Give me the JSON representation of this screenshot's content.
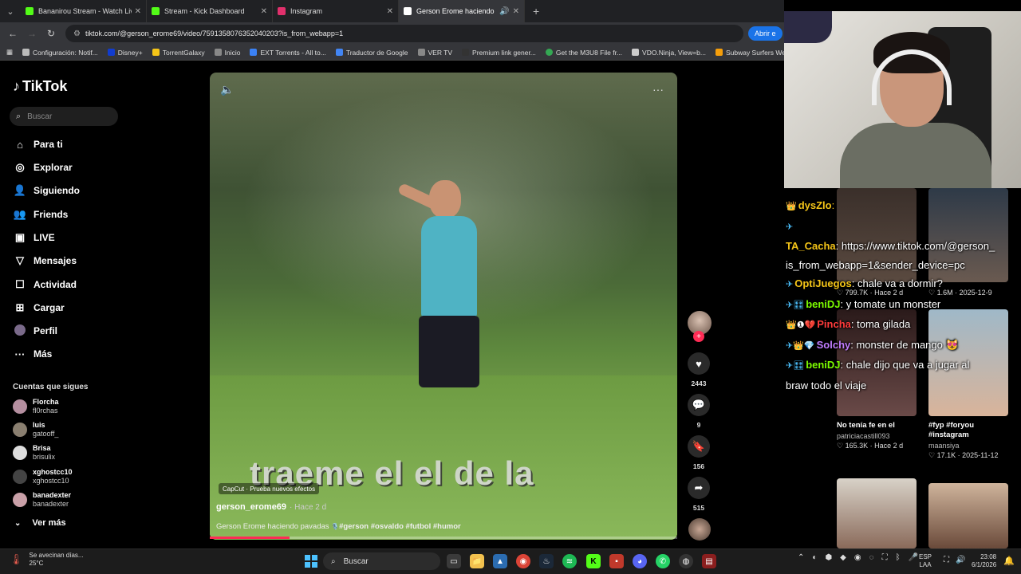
{
  "browser": {
    "tabs": [
      {
        "title": "Bananirou Stream - Watch Live",
        "favicon": "kick-icon",
        "color": "#53fc18"
      },
      {
        "title": "Stream - Kick Dashboard",
        "favicon": "kick-icon",
        "color": "#53fc18"
      },
      {
        "title": "Instagram",
        "favicon": "instagram-icon",
        "color": "#e1306c"
      },
      {
        "title": "Gerson Erome haciendo pa",
        "favicon": "tiktok-icon",
        "color": "#ffffff"
      }
    ],
    "url": "tiktok.com/@gerson_erome69/video/7591358076352040203?is_from_webapp=1",
    "open_app_label": "Abrir e",
    "bookmarks": [
      {
        "label": "Configuración: Notif...",
        "color": "#bbbbbb"
      },
      {
        "label": "Disney+",
        "color": "#113ccf"
      },
      {
        "label": "TorrentGalaxy",
        "color": "#f5c518"
      },
      {
        "label": "Inicio",
        "color": "#888888"
      },
      {
        "label": "EXT Torrents - All to...",
        "color": "#3b82f6"
      },
      {
        "label": "Traductor de Google",
        "color": "#4285f4"
      },
      {
        "label": "VER TV",
        "color": "#888888"
      },
      {
        "label": "Premium link gener...",
        "color": "#333333"
      },
      {
        "label": "Get the M3U8 File fr...",
        "color": "#34a853"
      },
      {
        "label": "VDO.Ninja, View=b...",
        "color": "#cccccc"
      },
      {
        "label": "Subway Surfers Web",
        "color": "#f59e0b"
      }
    ]
  },
  "tiktok": {
    "logo": "TikTok",
    "search_placeholder": "Buscar",
    "nav": [
      {
        "label": "Para ti",
        "icon": "home-icon"
      },
      {
        "label": "Explorar",
        "icon": "compass-icon"
      },
      {
        "label": "Siguiendo",
        "icon": "following-icon"
      },
      {
        "label": "Friends",
        "icon": "friends-icon"
      },
      {
        "label": "LIVE",
        "icon": "live-icon"
      },
      {
        "label": "Mensajes",
        "icon": "messages-icon"
      },
      {
        "label": "Actividad",
        "icon": "activity-icon"
      },
      {
        "label": "Cargar",
        "icon": "upload-icon"
      },
      {
        "label": "Perfil",
        "icon": "profile-icon"
      },
      {
        "label": "Más",
        "icon": "more-icon"
      }
    ],
    "following_title": "Cuentas que sigues",
    "following": [
      {
        "name": "Florcha",
        "handle": "fl0rchas"
      },
      {
        "name": "luis",
        "handle": "gatooff_"
      },
      {
        "name": "Brisa",
        "handle": "brisulix"
      },
      {
        "name": "xghostcc10",
        "handle": "xghostcc10"
      },
      {
        "name": "banadexter",
        "handle": "banadexter"
      }
    ],
    "see_more": "Ver más",
    "video": {
      "caption_overlay": "traeme el el de la",
      "capcut_label": "CapCut · Prueba nuevos efectos",
      "author": "gerson_erome69",
      "time": "· Hace 2 d",
      "description": "Gerson Erome haciendo pavadas",
      "hashtags": "#gerson #osvaldo #futbol #humor",
      "progress": 0.17
    },
    "actions": {
      "likes": "2443",
      "comments": "9",
      "saves": "156",
      "shares": "515"
    }
  },
  "overlay": {
    "chat": [
      {
        "badge": "👑",
        "user": "dysZlo",
        "color": "#f5c518",
        "text": ""
      },
      {
        "badge": "✈",
        "user": "",
        "color": "#4cc2ff",
        "text": ""
      },
      {
        "badge": "",
        "user": "TA_Cacha",
        "color": "#f5c518",
        "text": "https://www.tiktok.com/@gerson_"
      },
      {
        "badge": "",
        "user": "",
        "color": "#ffffff",
        "text": "is_from_webapp=1&sender_device=pc"
      },
      {
        "badge": "✈",
        "user": "OptiJuegos",
        "color": "#f5c518",
        "text": "chale va a dormir?"
      },
      {
        "badge": "✈🎛",
        "user": "beniDJ",
        "color": "#7CFC00",
        "text": "y tomate un monster"
      },
      {
        "badge": "👑❶💔",
        "user": "Pincha",
        "color": "#ff3b3b",
        "text": "toma gilada"
      },
      {
        "badge": "✈👑💎",
        "user": "Solchy",
        "color": "#c07cff",
        "text": "monster de mango 😻"
      },
      {
        "badge": "✈🎛",
        "user": "beniDJ",
        "color": "#7CFC00",
        "text": "chale dijo que va a jugar al"
      },
      {
        "badge": "",
        "user": "",
        "color": "#ffffff",
        "text": "braw todo el viaje"
      }
    ],
    "thumbs": [
      {
        "title": "No tenía fe en el",
        "author": "patriciacastill093",
        "stats": "♡ 165.3K · Hace 2 d"
      },
      {
        "title": "#fyp #foryou #instagram",
        "author": "maansiya",
        "stats": "♡ 17.1K · 2025-11-12"
      }
    ],
    "partial_stats": [
      {
        "text": "♡ 799.7K · Hace 2 d"
      },
      {
        "text": "♡ 1.6M · 2025-12-9"
      }
    ]
  },
  "taskbar": {
    "weather_title": "Se avecinan días...",
    "weather_temp": "25°C",
    "search": "Buscar",
    "lang_top": "ESP",
    "lang_bottom": "LAA",
    "time": "23:08",
    "date": "6/1/2026"
  }
}
